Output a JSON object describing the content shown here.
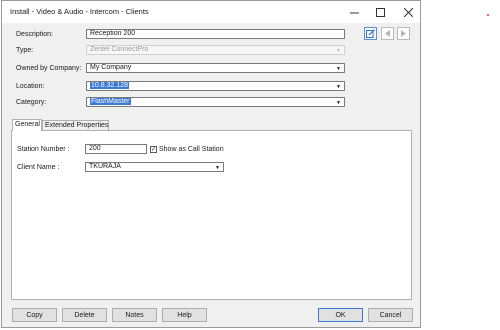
{
  "window": {
    "title": "Install - Video & Audio - Intercom - Clients"
  },
  "form": {
    "description_label": "Description:",
    "description_value": "Reception 200",
    "type_label": "Type:",
    "type_value": "Zentel ConnectPro",
    "owned_label": "Owned by Company:",
    "owned_value": "My Company",
    "location_label": "Location:",
    "location_value": "10.8.32.128",
    "category_label": "Category:",
    "category_value": "FlashMaster"
  },
  "tabs": [
    {
      "label": "General",
      "active": true
    },
    {
      "label": "Extended Properties",
      "active": false
    }
  ],
  "general": {
    "station_label": "Station Number :",
    "station_value": "200",
    "call_station_label": "Show as Call Station",
    "call_station_checked": true,
    "client_label": "Client Name :",
    "client_value": "TKURAJA"
  },
  "buttons": {
    "copy": "Copy",
    "delete": "Delete",
    "notes": "Notes",
    "help": "Help",
    "ok": "OK",
    "cancel": "Cancel"
  },
  "icons": {
    "edit": "edit-icon",
    "prev": "arrow-left-icon",
    "next": "arrow-right-icon"
  },
  "colors": {
    "selection": "#3a78d6",
    "accent_icon": "#2e6fc5"
  }
}
